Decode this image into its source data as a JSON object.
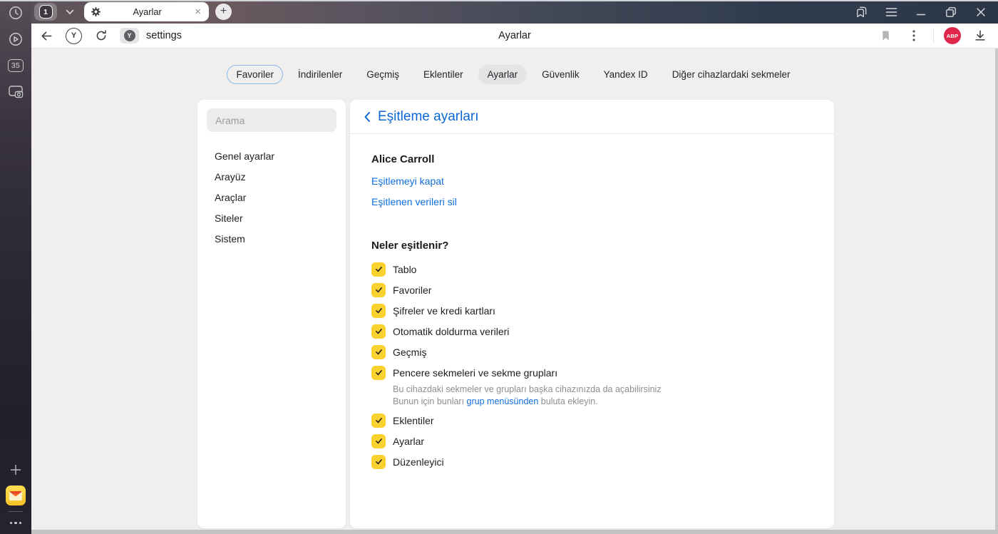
{
  "chrome": {
    "tab_count": "1",
    "tab_title": "Ayarlar",
    "new_tab_label": "+",
    "url_value": "settings",
    "page_title": "Ayarlar",
    "favicon_letter": "Y",
    "yandex_button_letter": "Y",
    "abp_label": "ABP"
  },
  "rail": {
    "tab_counter": "35"
  },
  "nav_tabs": [
    {
      "label": "Favoriler",
      "state": "outlined"
    },
    {
      "label": "İndirilenler"
    },
    {
      "label": "Geçmiş"
    },
    {
      "label": "Eklentiler"
    },
    {
      "label": "Ayarlar",
      "state": "active"
    },
    {
      "label": "Güvenlik"
    },
    {
      "label": "Yandex ID"
    },
    {
      "label": "Diğer cihazlardaki sekmeler"
    }
  ],
  "settings_nav": {
    "search_placeholder": "Arama",
    "items": [
      {
        "label": "Genel ayarlar"
      },
      {
        "label": "Arayüz"
      },
      {
        "label": "Araçlar"
      },
      {
        "label": "Siteler"
      },
      {
        "label": "Sistem"
      }
    ]
  },
  "sync": {
    "back_title": "Eşitleme ayarları",
    "account_name": "Alice Carroll",
    "link_disable": "Eşitlemeyi kapat",
    "link_delete": "Eşitlenen verileri sil",
    "section_title": "Neler eşitlenir?",
    "items": [
      {
        "label": "Tablo",
        "checked": true
      },
      {
        "label": "Favoriler",
        "checked": true
      },
      {
        "label": "Şifreler ve kredi kartları",
        "checked": true
      },
      {
        "label": "Otomatik doldurma verileri",
        "checked": true
      },
      {
        "label": "Geçmiş",
        "checked": true
      },
      {
        "label": "Pencere sekmeleri ve sekme grupları",
        "checked": true,
        "note1": "Bu cihazdaki sekmeler ve grupları başka cihazınızda da açabilirsiniz",
        "notePrefix": "Bunun için bunları ",
        "noteLink": "grup menüsünden",
        "noteSuffix": " buluta ekleyin."
      },
      {
        "label": "Eklentiler",
        "checked": true
      },
      {
        "label": "Ayarlar",
        "checked": true
      },
      {
        "label": "Düzenleyici",
        "checked": true
      }
    ]
  },
  "colors": {
    "accent_blue": "#0f6edb",
    "header_blue": "#0c66d4",
    "checkbox_yellow": "#fad22f",
    "abp_red": "#e0274a",
    "favorites_outline": "#86baf1",
    "page_background": "#f0efed"
  }
}
